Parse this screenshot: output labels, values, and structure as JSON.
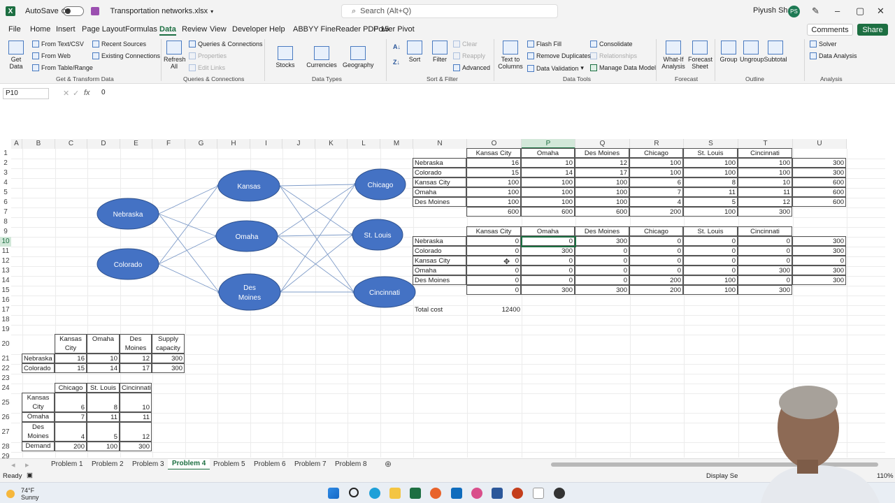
{
  "titlebar": {
    "autosave": "AutoSave",
    "toggle": "Off",
    "doc_title": "Transportation networks.xlsx",
    "search_placeholder": "Search (Alt+Q)",
    "user": "Piyush Shah",
    "user_initials": "PS"
  },
  "menu": {
    "tabs": [
      "File",
      "Home",
      "Insert",
      "Page Layout",
      "Formulas",
      "Data",
      "Review",
      "View",
      "Developer",
      "Help",
      "ABBYY FineReader PDF 15",
      "Power Pivot"
    ],
    "active": "Data",
    "comments": "Comments",
    "share": "Share"
  },
  "ribbon": {
    "get_data": "Get Data",
    "from_text": "From Text/CSV",
    "from_web": "From Web",
    "from_table": "From Table/Range",
    "recent_sources": "Recent Sources",
    "existing_conn": "Existing Connections",
    "group_get": "Get & Transform Data",
    "refresh": "Refresh All",
    "queries": "Queries & Connections",
    "properties": "Properties",
    "edit_links": "Edit Links",
    "group_queries": "Queries & Connections",
    "stocks": "Stocks",
    "currencies": "Currencies",
    "geography": "Geography",
    "group_types": "Data Types",
    "sort": "Sort",
    "filter": "Filter",
    "clear": "Clear",
    "reapply": "Reapply",
    "advanced": "Advanced",
    "group_sort": "Sort & Filter",
    "text_to_columns": "Text to Columns",
    "flash_fill": "Flash Fill",
    "remove_dup": "Remove Duplicates",
    "data_validation": "Data Validation",
    "consolidate": "Consolidate",
    "relationships": "Relationships",
    "manage_model": "Manage Data Model",
    "group_tools": "Data Tools",
    "what_if": "What-If Analysis",
    "forecast_sheet": "Forecast Sheet",
    "group_forecast": "Forecast",
    "group_btn": "Group",
    "ungroup": "Ungroup",
    "subtotal": "Subtotal",
    "group_outline": "Outline",
    "solver": "Solver",
    "data_analysis": "Data Analysis",
    "group_analysis": "Analysis"
  },
  "formula_bar": {
    "name_box": "P10",
    "fx": "fx",
    "value": "0"
  },
  "columns": [
    "A",
    "B",
    "C",
    "D",
    "E",
    "F",
    "G",
    "H",
    "I",
    "J",
    "K",
    "L",
    "M",
    "N",
    "O",
    "P",
    "Q",
    "R",
    "S",
    "T",
    "U"
  ],
  "rows": [
    "1",
    "2",
    "3",
    "4",
    "5",
    "6",
    "7",
    "8",
    "9",
    "10",
    "11",
    "12",
    "13",
    "14",
    "15",
    "16",
    "17",
    "18",
    "19",
    "20",
    "21",
    "22",
    "23",
    "24",
    "25",
    "26",
    "27",
    "28",
    "29"
  ],
  "network": {
    "nodes": [
      "Nebraska",
      "Colorado",
      "Kansas",
      "Omaha",
      "Des Moines",
      "Chicago",
      "St. Louis",
      "Cincinnati"
    ]
  },
  "cost_table": {
    "headers": [
      "Kansas City",
      "Omaha",
      "Des Moines",
      "Chicago",
      "St. Louis",
      "Cincinnati"
    ],
    "rows": [
      {
        "label": "Nebraska",
        "values": [
          "16",
          "10",
          "12",
          "100",
          "100",
          "100",
          "300"
        ]
      },
      {
        "label": "Colorado",
        "values": [
          "15",
          "14",
          "17",
          "100",
          "100",
          "100",
          "300"
        ]
      },
      {
        "label": "Kansas City",
        "values": [
          "100",
          "100",
          "100",
          "6",
          "8",
          "10",
          "600"
        ]
      },
      {
        "label": "Omaha",
        "values": [
          "100",
          "100",
          "100",
          "7",
          "11",
          "11",
          "600"
        ]
      },
      {
        "label": "Des Moines",
        "values": [
          "100",
          "100",
          "100",
          "4",
          "5",
          "12",
          "600"
        ]
      }
    ],
    "totals": [
      "600",
      "600",
      "600",
      "200",
      "100",
      "300"
    ]
  },
  "flow_table": {
    "headers": [
      "Kansas City",
      "Omaha",
      "Des Moines",
      "Chicago",
      "St. Louis",
      "Cincinnati"
    ],
    "rows": [
      {
        "label": "Nebraska",
        "values": [
          "0",
          "0",
          "300",
          "0",
          "0",
          "0",
          "300"
        ]
      },
      {
        "label": "Colorado",
        "values": [
          "0",
          "300",
          "0",
          "0",
          "0",
          "0",
          "300"
        ]
      },
      {
        "label": "Kansas City",
        "values": [
          "0",
          "0",
          "0",
          "0",
          "0",
          "0",
          "0"
        ]
      },
      {
        "label": "Omaha",
        "values": [
          "0",
          "0",
          "0",
          "0",
          "0",
          "300",
          "300"
        ]
      },
      {
        "label": "Des Moines",
        "values": [
          "0",
          "0",
          "0",
          "200",
          "100",
          "0",
          "300"
        ]
      }
    ],
    "totals": [
      "0",
      "300",
      "300",
      "200",
      "100",
      "300"
    ]
  },
  "total_cost": {
    "label": "Total cost",
    "value": "12400"
  },
  "supply_table": {
    "headers": [
      "Kansas City",
      "Omaha",
      "Des Moines",
      "Supply capacity"
    ],
    "rows": [
      {
        "label": "Nebraska",
        "values": [
          "16",
          "10",
          "12",
          "300"
        ]
      },
      {
        "label": "Colorado",
        "values": [
          "15",
          "14",
          "17",
          "300"
        ]
      }
    ]
  },
  "demand_table": {
    "headers": [
      "Chicago",
      "St. Louis",
      "Cincinnati"
    ],
    "rows": [
      {
        "label": "Kansas City",
        "values": [
          "6",
          "8",
          "10"
        ]
      },
      {
        "label": "Omaha",
        "values": [
          "7",
          "11",
          "11"
        ]
      },
      {
        "label": "Des Moines",
        "values": [
          "4",
          "5",
          "12"
        ]
      },
      {
        "label": "Demand",
        "values": [
          "200",
          "100",
          "300"
        ]
      }
    ]
  },
  "sheets": [
    "Problem 1",
    "Problem 2",
    "Problem 3",
    "Problem 4",
    "Problem 5",
    "Problem 6",
    "Problem 7",
    "Problem 8"
  ],
  "active_sheet": "Problem 4",
  "status": {
    "ready": "Ready",
    "display": "Display Se",
    "zoom": "110%"
  },
  "weather": {
    "temp": "74°F",
    "cond": "Sunny"
  },
  "colors": {
    "excel_green": "#1d6f42",
    "node_fill": "#4472c4",
    "edge": "#7f9cc9"
  }
}
